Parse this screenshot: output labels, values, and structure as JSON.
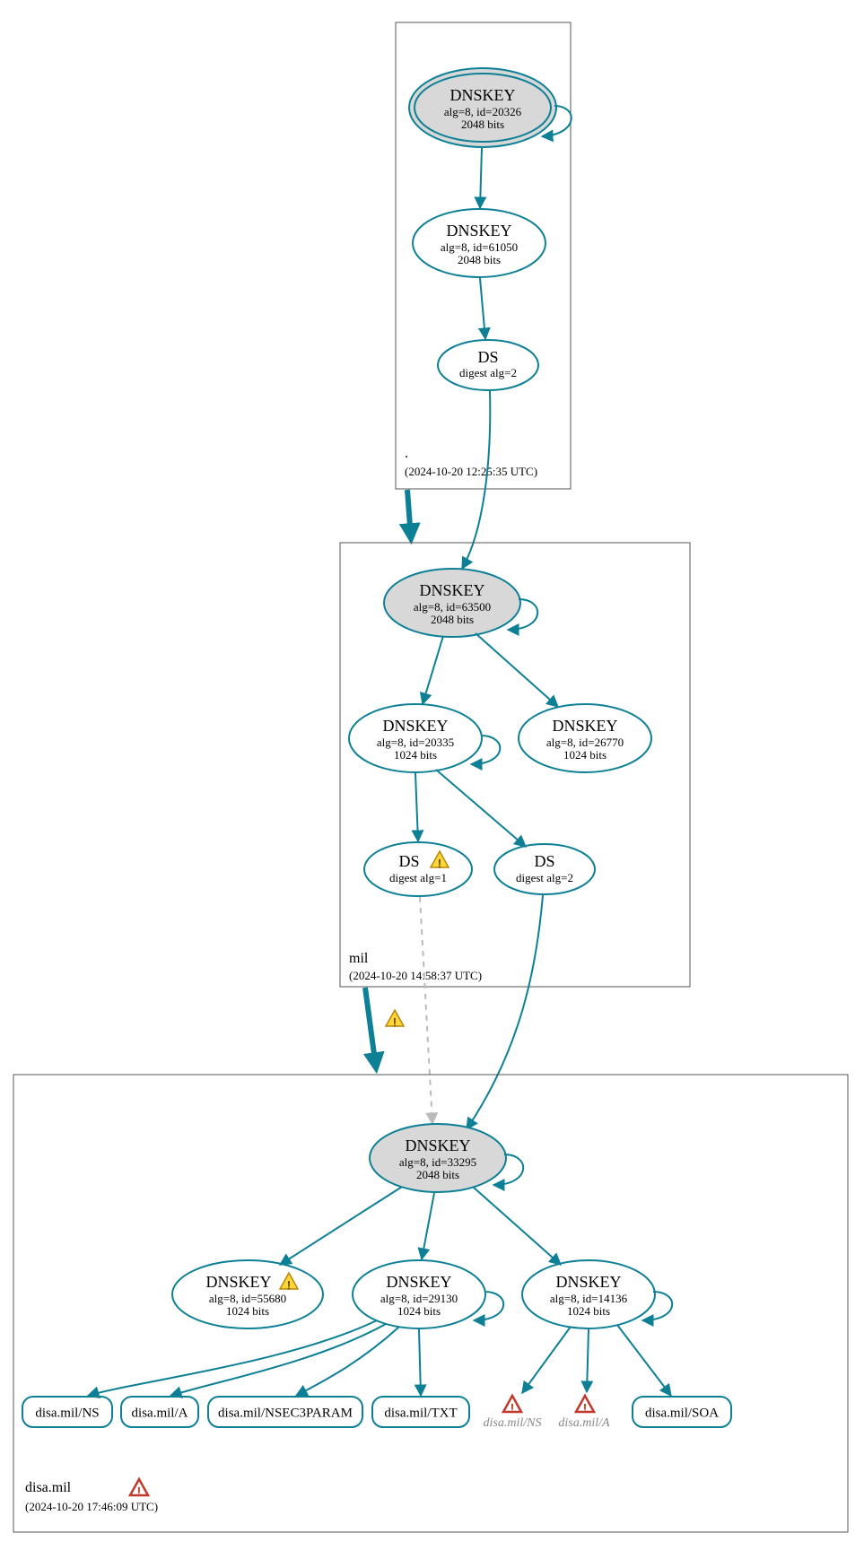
{
  "zones": {
    "root": {
      "label": ".",
      "timestamp": "(2024-10-20 12:25:35 UTC)"
    },
    "mil": {
      "label": "mil",
      "timestamp": "(2024-10-20 14:58:37 UTC)"
    },
    "disa": {
      "label": "disa.mil",
      "timestamp": "(2024-10-20 17:46:09 UTC)"
    }
  },
  "nodes": {
    "root_ksk": {
      "title": "DNSKEY",
      "line1": "alg=8, id=20326",
      "line2": "2048 bits"
    },
    "root_zsk": {
      "title": "DNSKEY",
      "line1": "alg=8, id=61050",
      "line2": "2048 bits"
    },
    "root_ds": {
      "title": "DS",
      "line1": "digest alg=2"
    },
    "mil_ksk": {
      "title": "DNSKEY",
      "line1": "alg=8, id=63500",
      "line2": "2048 bits"
    },
    "mil_zsk1": {
      "title": "DNSKEY",
      "line1": "alg=8, id=20335",
      "line2": "1024 bits"
    },
    "mil_zsk2": {
      "title": "DNSKEY",
      "line1": "alg=8, id=26770",
      "line2": "1024 bits"
    },
    "mil_ds1": {
      "title": "DS",
      "line1": "digest alg=1"
    },
    "mil_ds2": {
      "title": "DS",
      "line1": "digest alg=2"
    },
    "disa_ksk": {
      "title": "DNSKEY",
      "line1": "alg=8, id=33295",
      "line2": "2048 bits"
    },
    "disa_zsk1": {
      "title": "DNSKEY",
      "line1": "alg=8, id=55680",
      "line2": "1024 bits"
    },
    "disa_zsk2": {
      "title": "DNSKEY",
      "line1": "alg=8, id=29130",
      "line2": "1024 bits"
    },
    "disa_zsk3": {
      "title": "DNSKEY",
      "line1": "alg=8, id=14136",
      "line2": "1024 bits"
    },
    "rr_ns": {
      "label": "disa.mil/NS"
    },
    "rr_a": {
      "label": "disa.mil/A"
    },
    "rr_nsec3": {
      "label": "disa.mil/NSEC3PARAM"
    },
    "rr_txt": {
      "label": "disa.mil/TXT"
    },
    "rr_ns_ghost": {
      "label": "disa.mil/NS"
    },
    "rr_a_ghost": {
      "label": "disa.mil/A"
    },
    "rr_soa": {
      "label": "disa.mil/SOA"
    }
  },
  "colors": {
    "accent": "#0d8096",
    "ksk_fill": "#d8d8d8"
  }
}
